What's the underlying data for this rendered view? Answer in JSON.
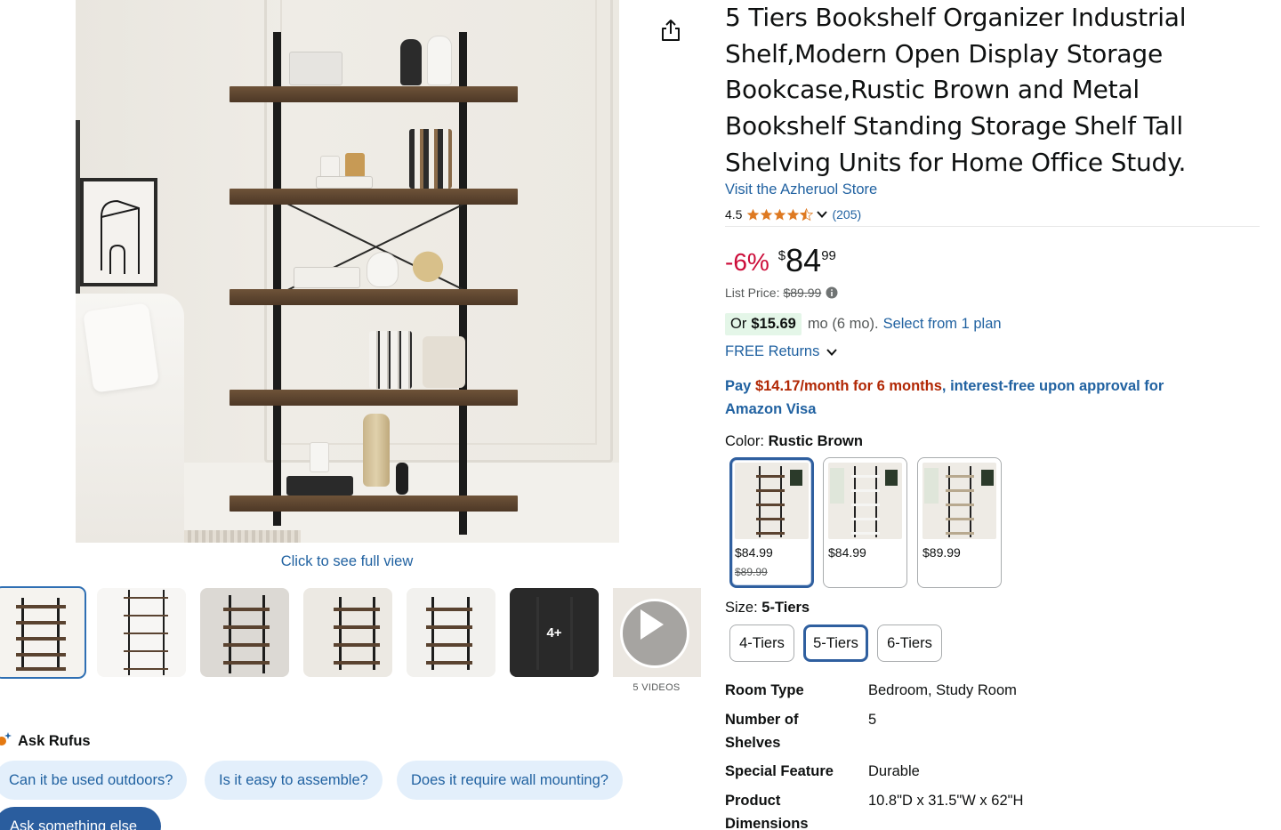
{
  "gallery": {
    "full_view_text": "Click to see full view",
    "thumbnails": [
      {
        "label": ""
      },
      {
        "label": ""
      },
      {
        "label": ""
      },
      {
        "label": ""
      },
      {
        "label": ""
      },
      {
        "label": "4+"
      }
    ],
    "video_count": "5 VIDEOS"
  },
  "rufus": {
    "title": "Ask Rufus",
    "chips": [
      "Can it be used outdoors?",
      "Is it easy to assemble?",
      "Does it require wall mounting?"
    ],
    "ask_else": "Ask something else"
  },
  "product": {
    "title": "5 Tiers Bookshelf Organizer Industrial Shelf,Modern Open Display Storage Bookcase,Rustic Brown and Metal Bookshelf Standing Storage Shelf Tall Shelving Units for Home Office Study.",
    "store_link": "Visit the Azheruol Store",
    "rating": "4.5",
    "rating_stars": 4.5,
    "rating_count": "(205)"
  },
  "price": {
    "discount": "-6%",
    "symbol": "$",
    "whole": "84",
    "fraction": "99",
    "list_label": "List Price:",
    "list_value": "$89.99"
  },
  "plan": {
    "or": "Or",
    "amount": "$15.69",
    "term": "mo (6 mo).",
    "link": "Select from 1 plan"
  },
  "returns": "FREE Returns",
  "visa": {
    "prefix": "Pay ",
    "amount": "$14.17/month for 6 months",
    "suffix": ", interest-free upon approval for Amazon Visa"
  },
  "color": {
    "label": "Color: ",
    "selected": "Rustic Brown",
    "options": [
      {
        "price": "$84.99",
        "list_price": "$89.99"
      },
      {
        "price": "$84.99",
        "list_price": ""
      },
      {
        "price": "$89.99",
        "list_price": ""
      }
    ]
  },
  "size": {
    "label": "Size: ",
    "selected": "5-Tiers",
    "options": [
      "4-Tiers",
      "5-Tiers",
      "6-Tiers"
    ]
  },
  "specs": [
    {
      "key": "Room Type",
      "value": "Bedroom, Study Room"
    },
    {
      "key": "Number of Shelves",
      "value": "5"
    },
    {
      "key": "Special Feature",
      "value": "Durable"
    },
    {
      "key": "Product Dimensions",
      "value": "10.8\"D x 31.5\"W x 62\"H"
    }
  ],
  "colors": {
    "link": "#2162a1",
    "discount": "#cc0c39",
    "visa_amount": "#b12704",
    "selected_border": "#2f5f9f",
    "chip_bg": "#e3effb",
    "plan_bg": "#e4f6e8",
    "star": "#de7921"
  },
  "icons": [
    "share-icon",
    "star-icon",
    "chevron-down-icon",
    "info-icon",
    "play-icon",
    "rufus-sparkle-icon"
  ]
}
